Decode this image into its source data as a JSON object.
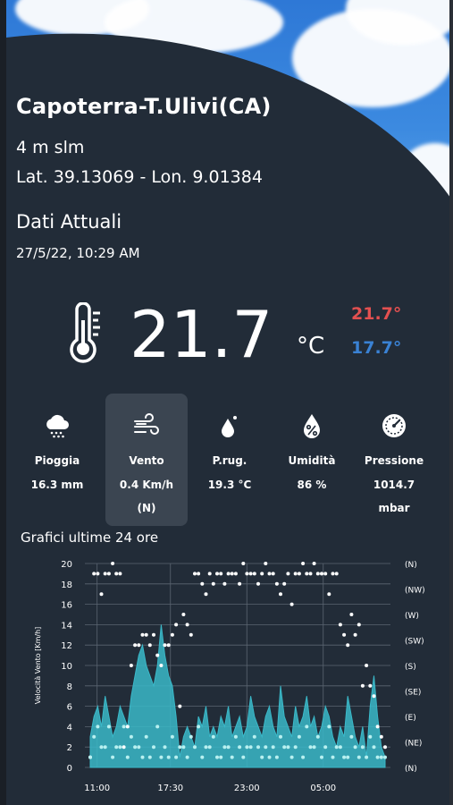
{
  "station": {
    "name": "Capoterra-T.Ulivi(CA)",
    "altitude": "4 m slm",
    "coordinates": "Lat. 39.13069 - Lon. 9.01384"
  },
  "current": {
    "section_title": "Dati Attuali",
    "timestamp": "27/5/22, 10:29 AM",
    "temperature": "21.7",
    "unit": "°C",
    "max": "21.7°",
    "min": "17.7°",
    "max_color": "#e35050",
    "min_color": "#3a82d4"
  },
  "metrics": [
    {
      "icon": "rain-cloud-icon",
      "label": "Pioggia",
      "value": "16.3 mm",
      "value2": ""
    },
    {
      "icon": "wind-icon",
      "label": "Vento",
      "value": "0.4 Km/h",
      "value2": "(N)"
    },
    {
      "icon": "dew-drop-icon",
      "label": "P.rug.",
      "value": "19.3 °C",
      "value2": ""
    },
    {
      "icon": "humidity-icon",
      "label": "Umidità",
      "value": "86 %",
      "value2": ""
    },
    {
      "icon": "gauge-icon",
      "label": "Pressione",
      "value": "1014.7",
      "value2": "mbar"
    }
  ],
  "selected_metric": "Vento",
  "chart_title": "Grafici ultime 24 ore",
  "chart_data": {
    "type": "area",
    "ylabel": "Velocità Vento [Km/h]",
    "xlabel": "",
    "ylim": [
      0,
      20
    ],
    "y_ticks": [
      "0",
      "2",
      "4",
      "6",
      "8",
      "10",
      "12",
      "14",
      "16",
      "18",
      "20"
    ],
    "x_ticks": [
      "11:00",
      "17:30",
      "23:00",
      "05:00"
    ],
    "y2_ticks": [
      "(N)",
      "(NE)",
      "(E)",
      "(SE)",
      "(S)",
      "(SW)",
      "(W)",
      "(NW)",
      "(N)"
    ],
    "series": [
      {
        "kind": "area",
        "color": "#3ab8c8",
        "values": [
          3,
          5,
          6,
          4,
          7,
          5,
          3,
          4,
          6,
          5,
          4,
          7,
          9,
          11,
          12,
          10,
          9,
          8,
          10,
          14,
          11,
          9,
          8,
          5,
          1,
          3,
          4,
          3,
          2,
          5,
          4,
          6,
          3,
          4,
          3,
          5,
          4,
          6,
          3,
          4,
          5,
          3,
          4,
          7,
          5,
          4,
          3,
          5,
          6,
          4,
          3,
          8,
          5,
          4,
          3,
          6,
          4,
          5,
          7,
          4,
          5,
          3,
          4,
          6,
          5,
          3,
          2,
          4,
          3,
          7,
          5,
          3,
          2,
          4,
          1,
          6,
          9,
          5,
          2,
          1
        ]
      },
      {
        "kind": "points",
        "color": "#ffffff",
        "values": [
          1,
          19,
          19,
          17,
          19,
          19,
          20,
          19,
          19,
          2,
          4,
          10,
          12,
          12,
          13,
          13,
          12,
          13,
          11,
          10,
          12,
          12,
          13,
          14,
          6,
          15,
          14,
          13,
          19,
          19,
          18,
          17,
          19,
          18,
          19,
          19,
          18,
          19,
          19,
          19,
          18,
          20,
          19,
          19,
          19,
          18,
          19,
          20,
          19,
          19,
          18,
          17,
          18,
          19,
          16,
          19,
          19,
          20,
          19,
          19,
          20,
          19,
          19,
          19,
          17,
          19,
          19,
          14,
          13,
          12,
          15,
          13,
          14,
          8,
          10,
          8,
          7,
          4,
          3,
          2
        ]
      },
      {
        "kind": "points",
        "color": "#b8f0f0",
        "values": [
          1,
          3,
          4,
          2,
          2,
          4,
          1,
          2,
          2,
          4,
          1,
          3,
          2,
          2,
          1,
          3,
          1,
          2,
          4,
          1,
          2,
          1,
          3,
          1,
          2,
          2,
          1,
          3,
          2,
          4,
          1,
          2,
          2,
          3,
          1,
          1,
          2,
          2,
          1,
          3,
          2,
          1,
          2,
          2,
          3,
          2,
          1,
          2,
          1,
          2,
          1,
          3,
          2,
          2,
          1,
          2,
          3,
          1,
          4,
          2,
          2,
          3,
          1,
          2,
          4,
          1,
          2,
          2,
          1,
          1,
          3,
          2,
          1,
          2,
          1,
          3,
          2,
          1,
          1,
          1
        ]
      }
    ]
  }
}
